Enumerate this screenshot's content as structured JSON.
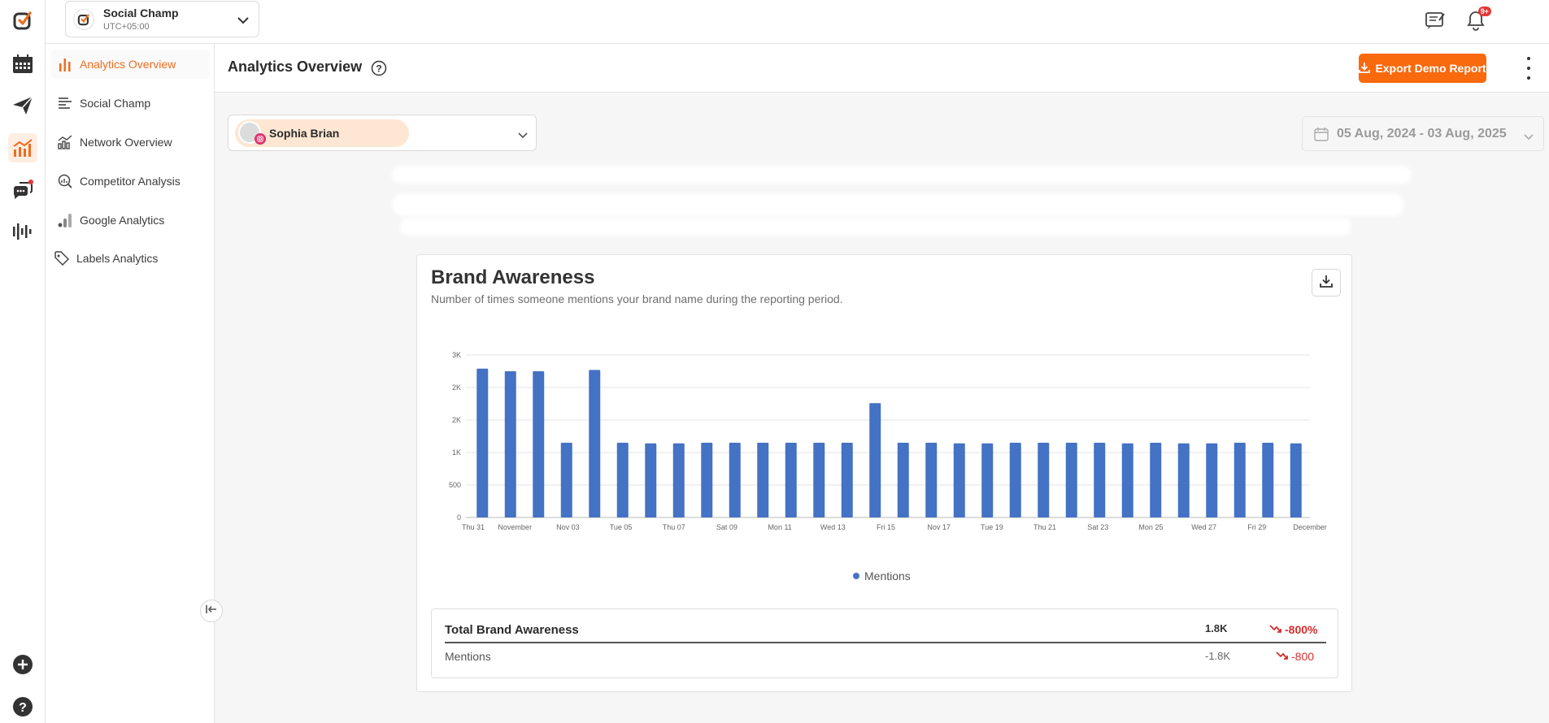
{
  "workspace": {
    "name": "Social Champ",
    "timezone": "UTC+05:00"
  },
  "notifications": {
    "badge": "9+"
  },
  "rail": {
    "icons": [
      "logo-icon",
      "calendar-icon",
      "send-icon",
      "analytics-icon",
      "chat-icon",
      "listening-icon",
      "add-icon",
      "help-icon"
    ]
  },
  "sidebar": {
    "items": [
      {
        "label": "Analytics Overview",
        "icon": "bar-chart-icon"
      },
      {
        "label": "Social Champ",
        "icon": "align-left-icon"
      },
      {
        "label": "Network Overview",
        "icon": "network-chart-icon"
      },
      {
        "label": "Competitor Analysis",
        "icon": "competitor-icon"
      },
      {
        "label": "Google Analytics",
        "icon": "google-analytics-icon"
      },
      {
        "label": "Labels Analytics",
        "icon": "tag-icon"
      }
    ]
  },
  "header": {
    "title": "Analytics Overview",
    "export_label": "Export Demo Report"
  },
  "filters": {
    "profile_name": "Sophia Brian",
    "date_range": "05 Aug, 2024 - 03 Aug, 2025"
  },
  "card": {
    "title": "Brand Awareness",
    "subtitle": "Number of times someone mentions your brand name during the reporting period."
  },
  "chart_data": {
    "type": "bar",
    "ylim": [
      0,
      2500
    ],
    "y_ticks": [
      {
        "value": 0,
        "label": "0"
      },
      {
        "value": 500,
        "label": "500"
      },
      {
        "value": 1000,
        "label": "1K"
      },
      {
        "value": 1500,
        "label": "2K"
      },
      {
        "value": 2000,
        "label": "2K"
      },
      {
        "value": 2500,
        "label": "3K"
      }
    ],
    "x_tick_labels": [
      "Thu 31",
      "November",
      "Nov 03",
      "Tue 05",
      "Thu 07",
      "Sat 09",
      "Mon 11",
      "Wed 13",
      "Fri 15",
      "Nov 17",
      "Tue 19",
      "Thu 21",
      "Sat 23",
      "Mon 25",
      "Wed 27",
      "Fri 29",
      "December"
    ],
    "series": [
      {
        "name": "Mentions",
        "color": "#4472c4",
        "values": [
          2290,
          2250,
          2250,
          1150,
          2270,
          1150,
          1140,
          1140,
          1150,
          1150,
          1150,
          1150,
          1150,
          1150,
          1760,
          1150,
          1150,
          1140,
          1140,
          1150,
          1150,
          1150,
          1150,
          1140,
          1150,
          1140,
          1140,
          1150,
          1150,
          1140
        ]
      }
    ],
    "legend": "bottom-center",
    "grid": true
  },
  "summary": {
    "total_label": "Total Brand Awareness",
    "total_value": "1.8K",
    "total_delta": "-800%",
    "row_label": "Mentions",
    "row_value": "-1.8K",
    "row_delta": "-800"
  }
}
